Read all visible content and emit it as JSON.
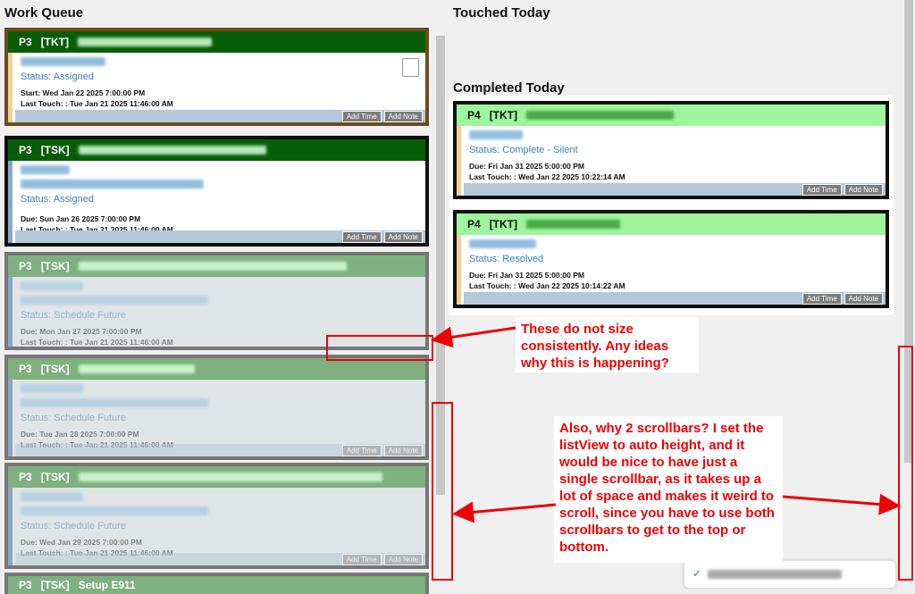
{
  "columns": {
    "work_queue": "Work Queue",
    "touched_today": "Touched Today",
    "completed_today": "Completed Today"
  },
  "cards": {
    "c1": {
      "priority": "P3",
      "type": "[TKT]",
      "status": "Status: Assigned",
      "date": "Start: Wed Jan 22 2025 7:00:00 PM",
      "last": "Last Touch: : Tue Jan 21 2025 11:46:00 AM"
    },
    "c2": {
      "priority": "P3",
      "type": "[TSK]",
      "status": "Status: Assigned",
      "date": "Due: Sun Jan 26 2025 7:00:00 PM",
      "last": "Last Touch: : Tue Jan 21 2025 11:46:00 AM"
    },
    "c3": {
      "priority": "P3",
      "type": "[TSK]",
      "status": "Status: Schedule Future",
      "date": "Due: Mon Jan 27 2025 7:00:00 PM",
      "last": "Last Touch: : Tue Jan 21 2025 11:46:00 AM"
    },
    "c4": {
      "priority": "P3",
      "type": "[TSK]",
      "status": "Status: Schedule Future",
      "date": "Due: Tue Jan 28 2025 7:00:00 PM",
      "last": "Last Touch: : Tue Jan 21 2025 11:46:00 AM"
    },
    "c5": {
      "priority": "P3",
      "type": "[TSK]",
      "status": "Status: Schedule Future",
      "date": "Due: Wed Jan 29 2025 7:00:00 PM",
      "last": "Last Touch: : Tue Jan 21 2025 11:46:00 AM"
    },
    "c6": {
      "priority": "P3",
      "type": "[TSK]",
      "title": "Setup E911"
    },
    "d1": {
      "priority": "P4",
      "type": "[TKT]",
      "status": "Status: Complete - Silent",
      "date": "Due: Fri Jan 31 2025 5:00:00 PM",
      "last": "Last Touch: : Wed Jan 22 2025 10:22:14 AM"
    },
    "d2": {
      "priority": "P4",
      "type": "[TKT]",
      "status": "Status: Resolved",
      "date": "Due: Fri Jan 31 2025 5:00:00 PM",
      "last": "Last Touch: : Wed Jan 22 2025 10:14:22 AM"
    }
  },
  "buttons": {
    "add_time": "Add Time",
    "add_note": "Add Note"
  },
  "annotations": {
    "note1": "These do not size consistently. Any ideas why this is happening?",
    "note2": "Also, why 2 scrollbars? I set the listView to auto height, and it would be nice to have just a single scrollbar, as it takes up a lot of space and makes it weird to scroll, since you have to use both scrollbars to get to the top or bottom."
  },
  "colors": {
    "dark_green": "#075d07",
    "light_green": "#9ef59b",
    "annotation_red": "#e00000",
    "status_blue": "#3f7fb2"
  }
}
